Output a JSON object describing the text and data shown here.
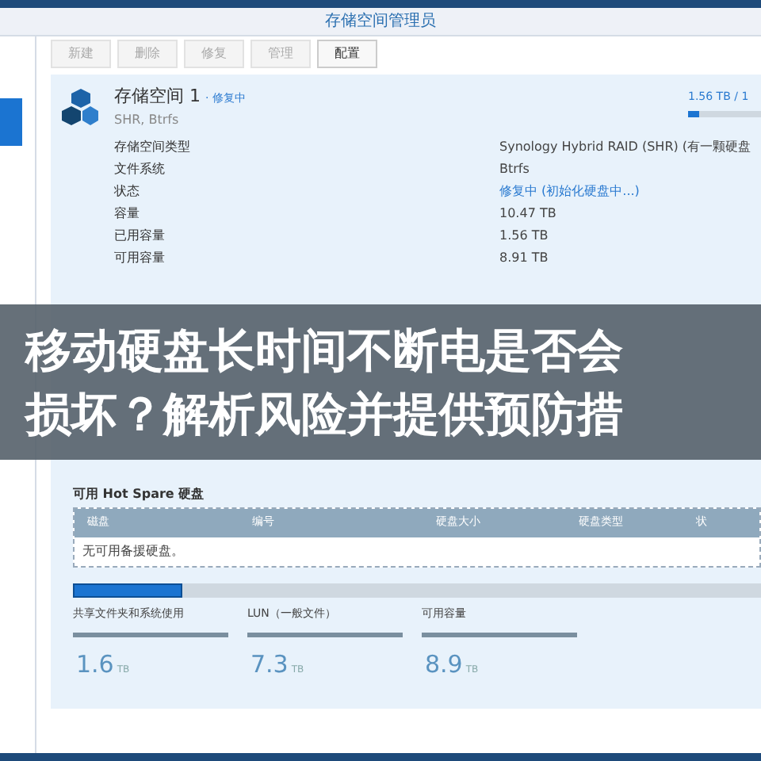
{
  "window": {
    "title": "存储空间管理员"
  },
  "toolbar": [
    {
      "label": "新建",
      "disabled": true
    },
    {
      "label": "删除",
      "disabled": true
    },
    {
      "label": "修复",
      "disabled": true
    },
    {
      "label": "管理",
      "disabled": true
    },
    {
      "label": "配置",
      "disabled": false
    }
  ],
  "volume": {
    "name": "存储空间 1",
    "status_tag": "· 修复中",
    "subtitle": "SHR, Btrfs",
    "usage_text": "1.56 TB / 1",
    "level": 0.16,
    "details": [
      {
        "label": "存储空间类型",
        "value": "Synology Hybrid RAID (SHR) (有一颗硬盘",
        "kind": "plain"
      },
      {
        "label": "文件系统",
        "value": "Btrfs",
        "kind": "plain"
      },
      {
        "label": "状态",
        "value": "修复中 (初始化硬盘中...)",
        "kind": "link"
      },
      {
        "label": "容量",
        "value": "10.47 TB",
        "kind": "plain"
      },
      {
        "label": "已用容量",
        "value": "1.56 TB",
        "kind": "plain"
      },
      {
        "label": "可用容量",
        "value": "8.91 TB",
        "kind": "plain"
      }
    ]
  },
  "hot_spare": {
    "title": "可用 Hot Spare 硬盘",
    "columns": [
      "磁盘",
      "编号",
      "硬盘大小",
      "硬盘类型",
      "状"
    ],
    "empty_text": "无可用备援硬盘。"
  },
  "usage": {
    "level": 0.16,
    "items": [
      {
        "label": "共享文件夹和系统使用",
        "value": "1.6",
        "unit": "TB"
      },
      {
        "label": "LUN（一般文件）",
        "value": "7.3",
        "unit": "TB"
      },
      {
        "label": "可用容量",
        "value": "8.9",
        "unit": "TB"
      }
    ]
  },
  "banner": {
    "lines": [
      "移动硬盘长时间不断电是否会",
      "损坏？解析风险并提供预防措"
    ]
  }
}
